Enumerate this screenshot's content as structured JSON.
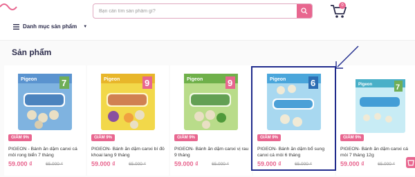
{
  "search": {
    "placeholder": "Bạn cần tìm sản phẩm gì?"
  },
  "cart": {
    "count": "0"
  },
  "menu": {
    "label": "Danh mục sản phẩm"
  },
  "section": {
    "title": "Sản phẩm"
  },
  "products": [
    {
      "badge": "GIẢM 9%",
      "name": "PIGEON - Bánh ăn dặm canxi cá môi rong biển 7 tháng",
      "price": "59.000 ₫",
      "old_price": "65.000 ₫",
      "age": "7"
    },
    {
      "badge": "GIẢM 9%",
      "name": "PIGEON- Bánh ăn dặm canxi bí đỏ khoai lang 9 tháng",
      "price": "59.000 ₫",
      "old_price": "65.000 ₫",
      "age": "9"
    },
    {
      "badge": "GIẢM 9%",
      "name": "PIGEON- Bánh ăn dặm canxi vị rau 9 tháng",
      "price": "59.000 ₫",
      "old_price": "65.000 ₫",
      "age": "9"
    },
    {
      "badge": "GIẢM 9%",
      "name": "PIGEON- Bánh ăn dặm bổ sung canxi cá mòi 6 tháng",
      "price": "59.000 ₫",
      "old_price": "65.000 ₫",
      "age": "6"
    },
    {
      "badge": "GIẢM 9%",
      "name": "PIGEON- Bánh ăn dặm canxi cá mòi 7 tháng 12g",
      "price": "59.000 ₫",
      "old_price": "65.000 ₫",
      "age": "7"
    }
  ],
  "colors": {
    "accent": "#e8668f",
    "navy": "#2b2b4b",
    "highlight": "#1f2a8c"
  }
}
